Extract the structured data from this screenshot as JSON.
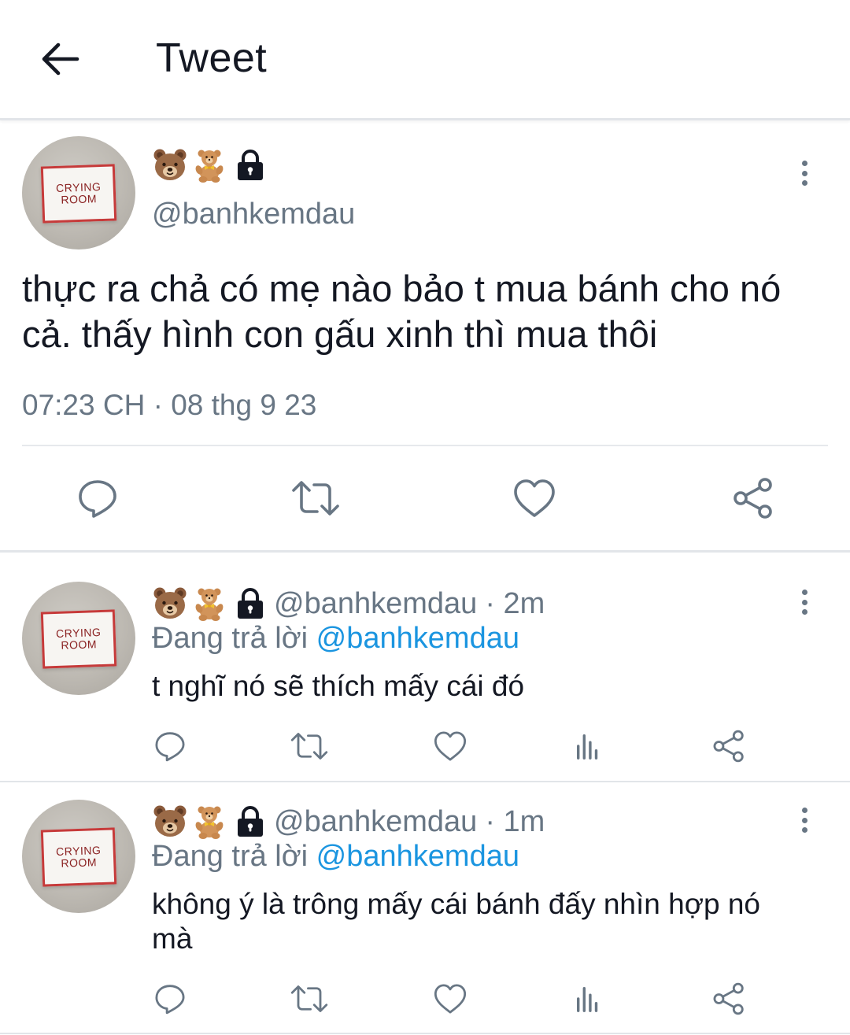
{
  "header": {
    "title": "Tweet",
    "back_icon": "arrow-left-icon"
  },
  "main_tweet": {
    "avatar_text_line1": "CRYING",
    "avatar_text_line2": "ROOM",
    "display_name_icons": [
      "bear-face-emoji",
      "teddy-bear-emoji",
      "lock-icon"
    ],
    "handle": "@banhkemdau",
    "text": "thực ra chả có mẹ nào bảo t mua bánh cho nó cả. thấy hình con gấu xinh thì mua thôi",
    "timestamp": "07:23 CH · 08 thg 9 23",
    "actions": [
      "reply-icon",
      "retweet-icon",
      "like-icon",
      "share-icon"
    ]
  },
  "replies": [
    {
      "handle": "@banhkemdau",
      "time": "· 2m",
      "replying_prefix": "Đang trả lời",
      "replying_to": "@banhkemdau",
      "text": "t nghĩ nó sẽ thích mấy cái đó",
      "avatar_text_line1": "CRYING",
      "avatar_text_line2": "ROOM"
    },
    {
      "handle": "@banhkemdau",
      "time": "· 1m",
      "replying_prefix": "Đang trả lời",
      "replying_to": "@banhkemdau",
      "text": "không ý là trông mấy cái bánh đấy nhìn hợp nó mà",
      "avatar_text_line1": "CRYING",
      "avatar_text_line2": "ROOM"
    }
  ],
  "colors": {
    "text": "#141823",
    "secondary": "#687684",
    "link": "#1b95e0",
    "divider": "#e2e5e9"
  }
}
